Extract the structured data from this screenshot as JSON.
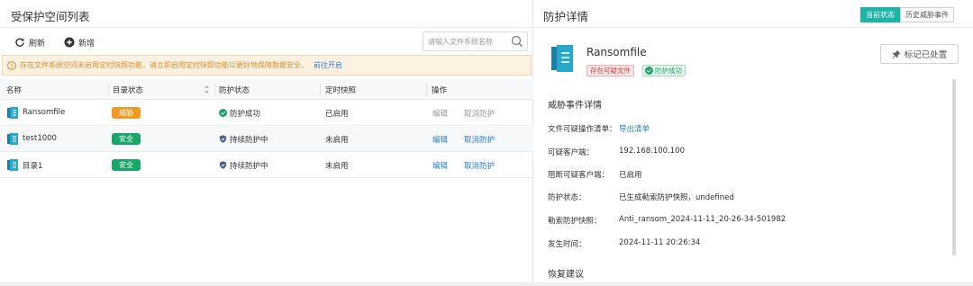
{
  "left": {
    "title": "受保护空间列表",
    "toolbar": {
      "refresh_label": "刷新",
      "add_label": "新增"
    },
    "search": {
      "placeholder": "请输入文件系统名称"
    },
    "warning": {
      "text": "存在文件系统空间未启用定时快照功能，请立即启用定时快照功能以更好地保障数据安全。",
      "link": "前往开启"
    },
    "columns": [
      "名称",
      "目录状态",
      "防护状态",
      "定时快照",
      "操作"
    ],
    "rows": [
      {
        "name": "Ransomfile",
        "status": "威胁",
        "status_type": "warn",
        "protection": "防护成功",
        "snapshot": "已启用",
        "op1": "编辑",
        "op2": "取消防护",
        "op_enabled": false
      },
      {
        "name": "test1000",
        "status": "安全",
        "status_type": "ok",
        "protection": "持续防护中",
        "snapshot": "未启用",
        "op1": "编辑",
        "op2": "取消防护",
        "op_enabled": true
      },
      {
        "name": "目录1",
        "status": "安全",
        "status_type": "ok",
        "protection": "持续防护中",
        "snapshot": "未启用",
        "op1": "编辑",
        "op2": "取消防护",
        "op_enabled": true
      }
    ]
  },
  "right": {
    "title": "防护详情",
    "tabs": {
      "current": "当前状态",
      "history": "历史威胁事件"
    },
    "file_name": "Ransomfile",
    "tags": {
      "danger": "存在可疑文件",
      "success": "防护成功"
    },
    "mark_button": "标记已处置",
    "section_title": "威胁事件详情",
    "details": [
      {
        "label": "文件可疑操作清单：",
        "value": "导出清单",
        "is_link": true
      },
      {
        "label": "可疑客户端：",
        "value": "192.168.100.100",
        "is_link": false
      },
      {
        "label": "阻断可疑客户端：",
        "value": "已启用",
        "is_link": false
      },
      {
        "label": "防护状态：",
        "value": "已生成勒索防护快照，undefined",
        "is_link": false
      },
      {
        "label": "勒索防护快照：",
        "value": "Anti_ransom_2024-11-11_20-26-34-501982",
        "is_link": false
      },
      {
        "label": "发生时间：",
        "value": "2024-11-11 20:26:34",
        "is_link": false
      }
    ],
    "recovery_title": "恢复建议"
  },
  "colors": {
    "accent": "#1cb4a7",
    "link": "#2b7fd6",
    "warn": "#f29a23",
    "ok": "#1aa56a",
    "danger": "#d23c3c"
  },
  "icons": [
    "refresh-icon",
    "plus-circle-icon",
    "search-icon",
    "warning-icon",
    "sort-icon",
    "folder-icon",
    "shield-icon",
    "check-circle-icon",
    "file-icon",
    "pin-icon"
  ]
}
